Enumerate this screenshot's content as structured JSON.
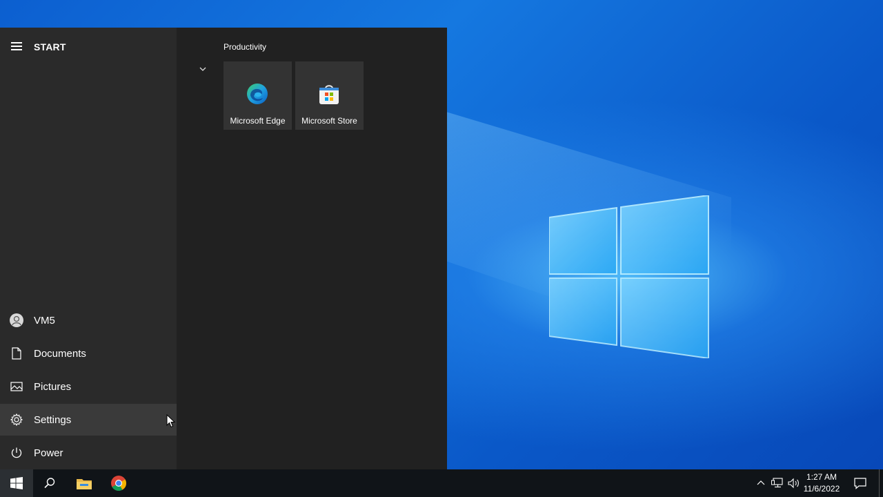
{
  "start_menu": {
    "title": "START",
    "rail_items": [
      {
        "label": "VM5",
        "icon": "user-avatar-icon"
      },
      {
        "label": "Documents",
        "icon": "document-icon"
      },
      {
        "label": "Pictures",
        "icon": "pictures-icon"
      },
      {
        "label": "Settings",
        "icon": "gear-icon"
      },
      {
        "label": "Power",
        "icon": "power-icon"
      }
    ],
    "group": {
      "title": "Productivity",
      "tiles": [
        {
          "label": "Microsoft Edge",
          "icon": "edge-icon"
        },
        {
          "label": "Microsoft Store",
          "icon": "store-icon"
        }
      ]
    }
  },
  "taskbar": {
    "apps": [
      "windows-start-icon",
      "search-icon",
      "file-explorer-icon",
      "chrome-icon"
    ],
    "clock": {
      "time": "1:27 AM",
      "date": "11/6/2022"
    }
  },
  "colors": {
    "menu_bg": "#212121",
    "rail_bg": "#2a2a2a",
    "tile_bg": "#333333",
    "taskbar_bg": "#101418"
  }
}
